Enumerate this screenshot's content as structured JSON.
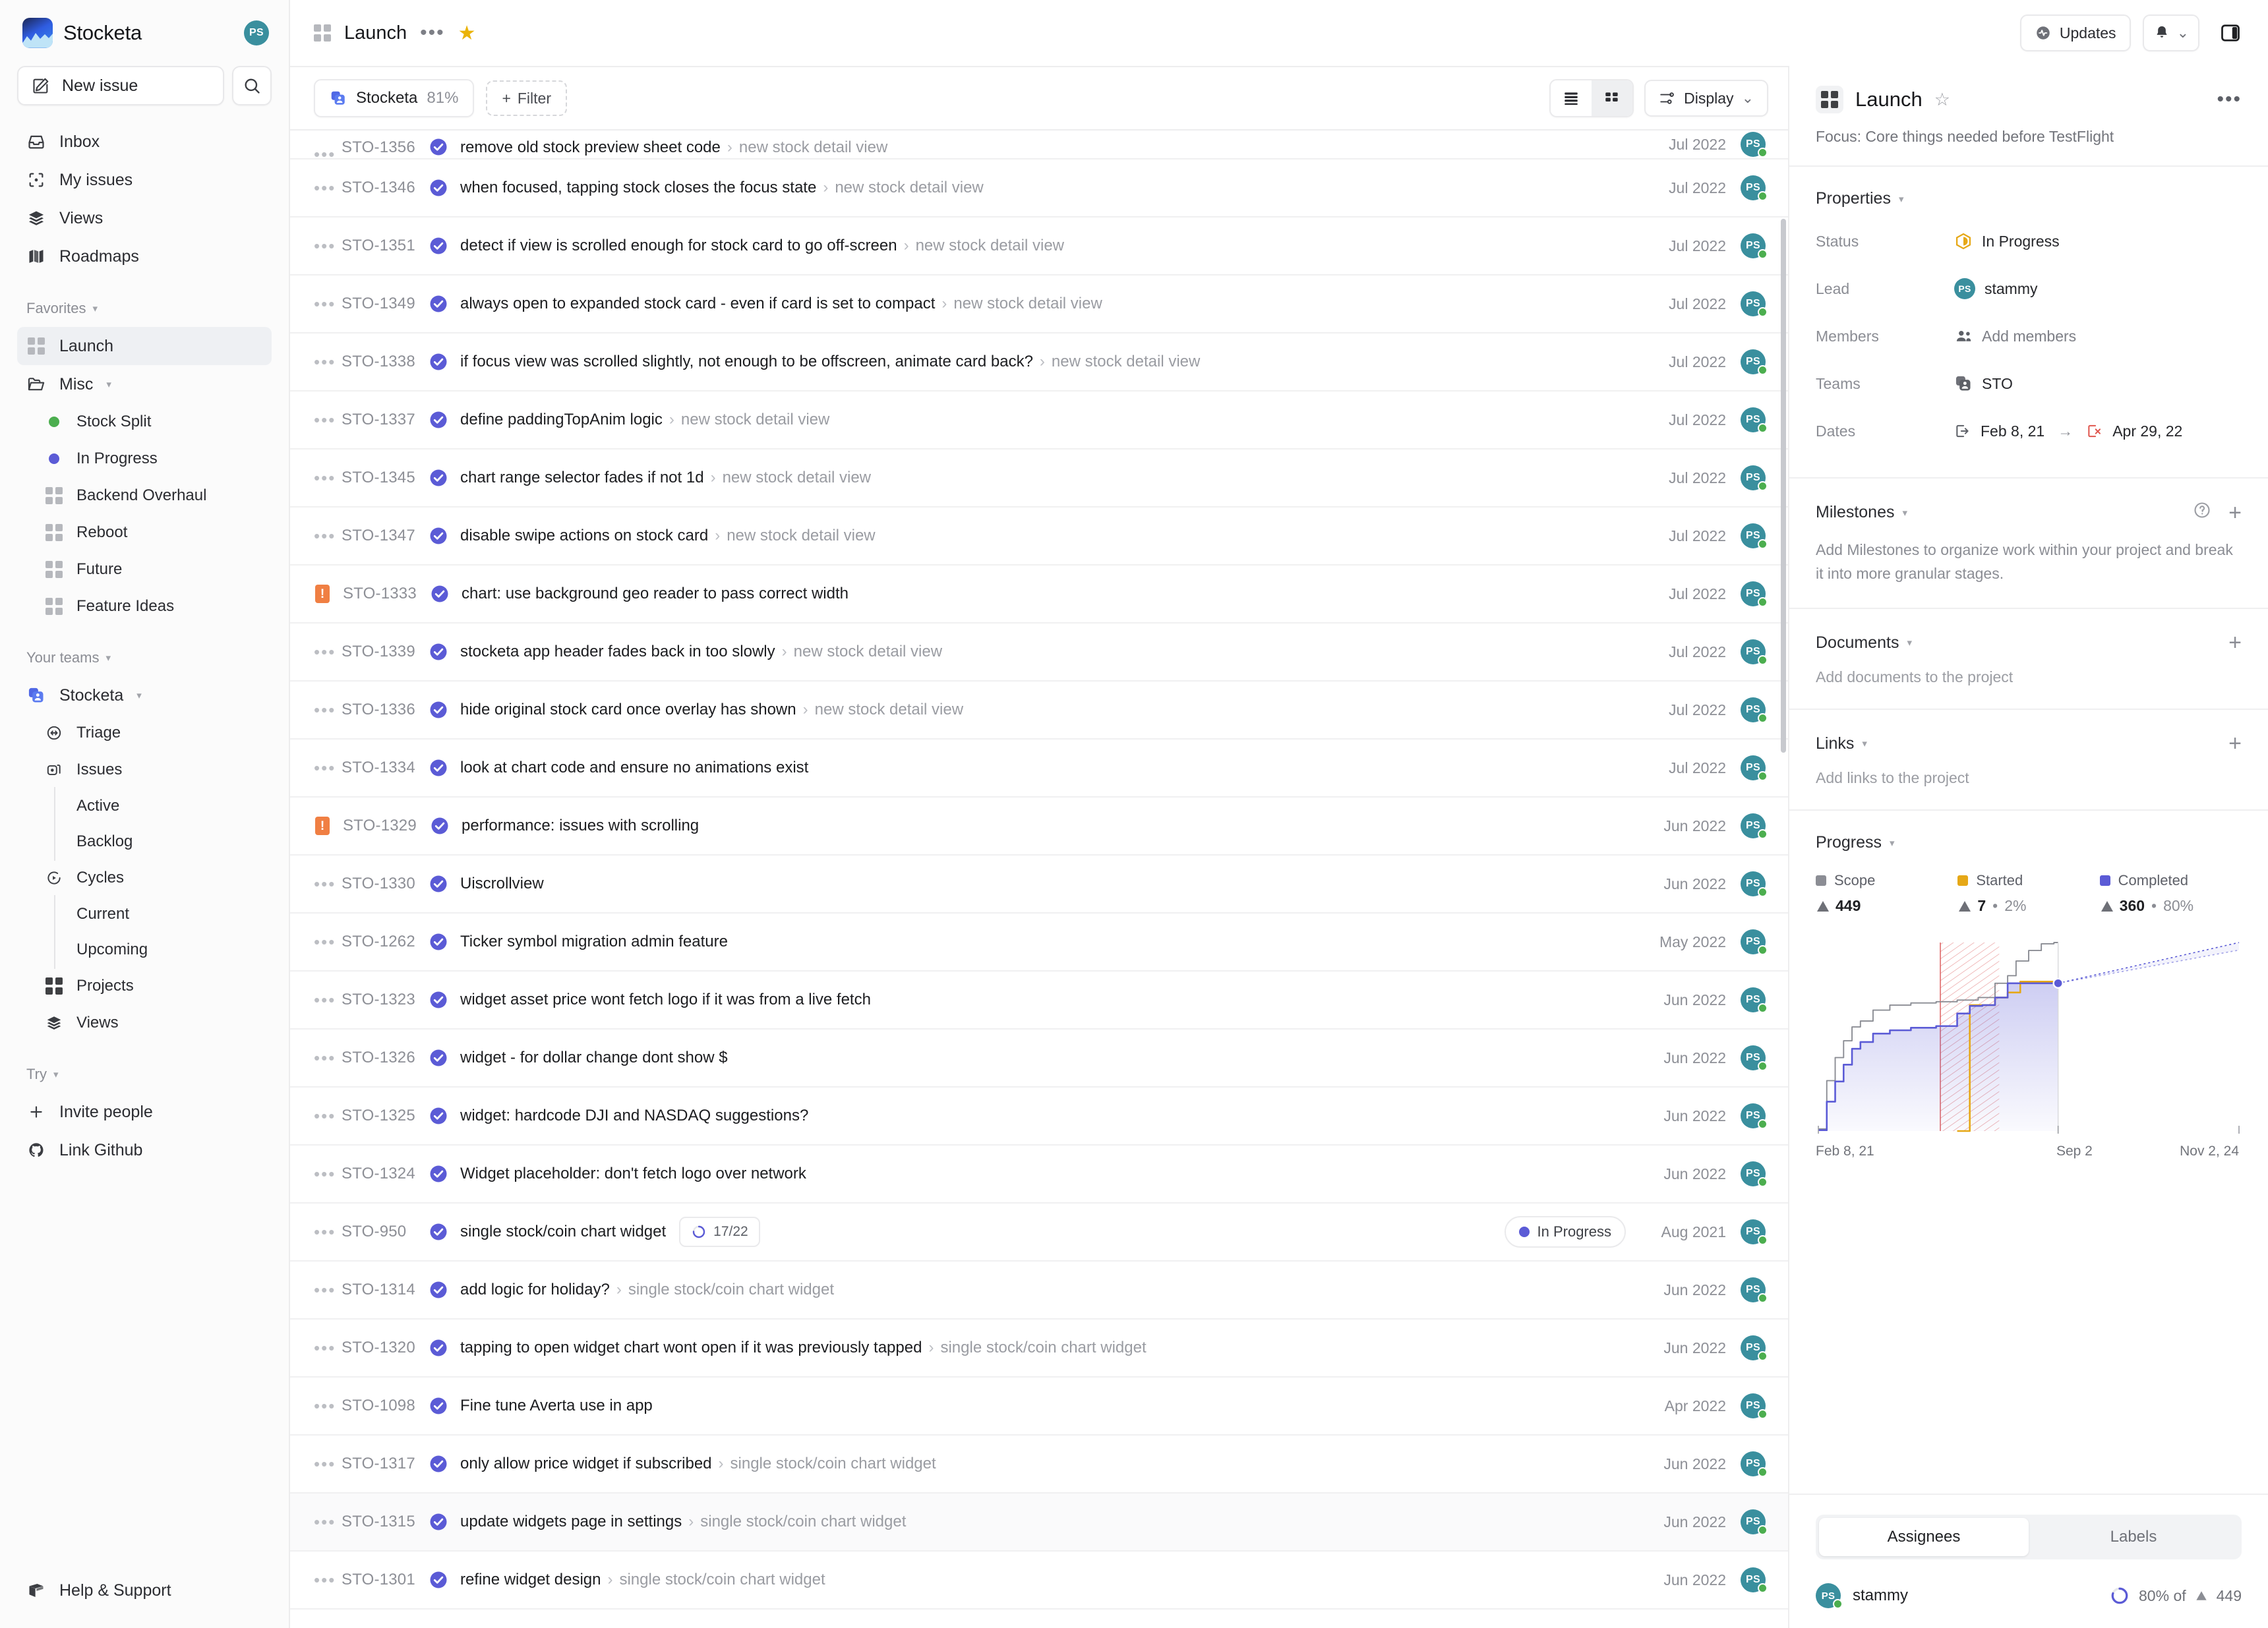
{
  "sidebar": {
    "brand": {
      "name": "Stocketa",
      "logo_icon": "stocketa-logo",
      "avatar_initials": "PS"
    },
    "new_issue_label": "New issue",
    "search_icon": "search-icon",
    "nav": [
      {
        "label": "Inbox",
        "icon": "inbox-icon"
      },
      {
        "label": "My issues",
        "icon": "my-issues-icon"
      },
      {
        "label": "Views",
        "icon": "views-layers-icon"
      },
      {
        "label": "Roadmaps",
        "icon": "roadmaps-map-icon"
      }
    ],
    "favorites_label": "Favorites",
    "favorites": [
      {
        "label": "Launch",
        "icon": "project-grid-icon",
        "active": true
      },
      {
        "label": "Misc",
        "icon": "folder-icon",
        "is_folder": true
      }
    ],
    "misc_children": [
      {
        "label": "Stock Split",
        "icon": "status-dot",
        "color": "#4cae4f"
      },
      {
        "label": "In Progress",
        "icon": "status-dot",
        "color": "#5b5bd6"
      },
      {
        "label": "Backend Overhaul",
        "icon": "project-grid-icon"
      },
      {
        "label": "Reboot",
        "icon": "project-grid-icon"
      },
      {
        "label": "Future",
        "icon": "project-grid-icon"
      },
      {
        "label": "Feature Ideas",
        "icon": "project-grid-icon"
      }
    ],
    "teams_label": "Your teams",
    "team": {
      "label": "Stocketa",
      "icon": "team-avatar-icon"
    },
    "team_children": [
      {
        "label": "Triage",
        "icon": "triage-icon",
        "depth": 1
      },
      {
        "label": "Issues",
        "icon": "issues-icon",
        "depth": 1
      },
      {
        "label": "Active",
        "depth": 2
      },
      {
        "label": "Backlog",
        "depth": 2
      },
      {
        "label": "Cycles",
        "icon": "cycles-icon",
        "depth": 1
      },
      {
        "label": "Current",
        "depth": 2
      },
      {
        "label": "Upcoming",
        "depth": 2
      },
      {
        "label": "Projects",
        "icon": "project-grid-icon",
        "depth": 1
      },
      {
        "label": "Views",
        "icon": "views-layers-icon",
        "depth": 1
      }
    ],
    "try_label": "Try",
    "try_items": [
      {
        "label": "Invite people",
        "icon": "plus-icon"
      },
      {
        "label": "Link Github",
        "icon": "github-icon"
      }
    ],
    "help_label": "Help & Support",
    "help_icon": "book-icon"
  },
  "topbar": {
    "project_icon": "project-grid-icon",
    "title": "Launch",
    "more_icon": "more-dots-icon",
    "favorite_icon": "star-filled-icon",
    "updates_label": "Updates",
    "updates_icon": "activity-icon",
    "bell_icon": "bell-icon",
    "chevron_icon": "chevron-down-icon",
    "panel_toggle_icon": "right-panel-toggle-icon"
  },
  "filterbar": {
    "team_chip": {
      "label": "Stocketa",
      "percent": "81%",
      "icon": "team-avatar-icon"
    },
    "filter_label": "Filter",
    "filter_plus": "+",
    "view_list_icon": "list-view-icon",
    "view_board_icon": "board-view-icon",
    "display_label": "Display",
    "display_icon": "sliders-icon",
    "display_chevron": "chevron-down-icon"
  },
  "issues": [
    {
      "id": "STO-1356",
      "title": "remove old stock preview sheet code",
      "breadcrumb": "new stock detail view",
      "date": "Jul 2022",
      "priority": "none",
      "status": "done",
      "avatar": "PS",
      "clipped": true
    },
    {
      "id": "STO-1346",
      "title": "when focused, tapping stock closes the focus state",
      "breadcrumb": "new stock detail view",
      "date": "Jul 2022",
      "priority": "none",
      "status": "done",
      "avatar": "PS"
    },
    {
      "id": "STO-1351",
      "title": "detect if view is scrolled enough for stock card to go off-screen",
      "breadcrumb": "new stock detail view",
      "date": "Jul 2022",
      "priority": "none",
      "status": "done",
      "avatar": "PS"
    },
    {
      "id": "STO-1349",
      "title": "always open to expanded stock card - even if card is set to compact",
      "breadcrumb": "new stock detail view",
      "date": "Jul 2022",
      "priority": "none",
      "status": "done",
      "avatar": "PS"
    },
    {
      "id": "STO-1338",
      "title": "if focus view was scrolled slightly, not enough to be offscreen, animate card back?",
      "breadcrumb": "new stock detail view",
      "date": "Jul 2022",
      "priority": "none",
      "status": "done",
      "avatar": "PS"
    },
    {
      "id": "STO-1337",
      "title": "define paddingTopAnim logic",
      "breadcrumb": "new stock detail view",
      "date": "Jul 2022",
      "priority": "none",
      "status": "done",
      "avatar": "PS"
    },
    {
      "id": "STO-1345",
      "title": "chart range selector fades if not 1d",
      "breadcrumb": "new stock detail view",
      "date": "Jul 2022",
      "priority": "none",
      "status": "done",
      "avatar": "PS"
    },
    {
      "id": "STO-1347",
      "title": "disable swipe actions on stock card",
      "breadcrumb": "new stock detail view",
      "date": "Jul 2022",
      "priority": "none",
      "status": "done",
      "avatar": "PS"
    },
    {
      "id": "STO-1333",
      "title": "chart: use background geo reader to pass correct width",
      "breadcrumb": "",
      "date": "Jul 2022",
      "priority": "urgent",
      "status": "done",
      "avatar": "PS"
    },
    {
      "id": "STO-1339",
      "title": "stocketa app header fades back in too slowly",
      "breadcrumb": "new stock detail view",
      "date": "Jul 2022",
      "priority": "none",
      "status": "done",
      "avatar": "PS"
    },
    {
      "id": "STO-1336",
      "title": "hide original stock card once overlay has shown",
      "breadcrumb": "new stock detail view",
      "date": "Jul 2022",
      "priority": "none",
      "status": "done",
      "avatar": "PS"
    },
    {
      "id": "STO-1334",
      "title": "look at chart code and ensure no animations exist",
      "breadcrumb": "",
      "date": "Jul 2022",
      "priority": "none",
      "status": "done",
      "avatar": "PS"
    },
    {
      "id": "STO-1329",
      "title": "performance: issues with scrolling",
      "breadcrumb": "",
      "date": "Jun 2022",
      "priority": "urgent",
      "status": "done",
      "avatar": "PS"
    },
    {
      "id": "STO-1330",
      "title": "Uiscrollview",
      "breadcrumb": "",
      "date": "Jun 2022",
      "priority": "none",
      "status": "done",
      "avatar": "PS"
    },
    {
      "id": "STO-1262",
      "title": "Ticker symbol migration admin feature",
      "breadcrumb": "",
      "date": "May 2022",
      "priority": "none",
      "status": "done",
      "avatar": "PS"
    },
    {
      "id": "STO-1323",
      "title": "widget asset price wont fetch logo if it was from a live fetch",
      "breadcrumb": "",
      "date": "Jun 2022",
      "priority": "none",
      "status": "done",
      "avatar": "PS"
    },
    {
      "id": "STO-1326",
      "title": "widget - for dollar change dont show $",
      "breadcrumb": "",
      "date": "Jun 2022",
      "priority": "none",
      "status": "done",
      "avatar": "PS"
    },
    {
      "id": "STO-1325",
      "title": "widget: hardcode DJI and NASDAQ suggestions?",
      "breadcrumb": "",
      "date": "Jun 2022",
      "priority": "none",
      "status": "done",
      "avatar": "PS"
    },
    {
      "id": "STO-1324",
      "title": "Widget placeholder: don't fetch logo over network",
      "breadcrumb": "",
      "date": "Jun 2022",
      "priority": "none",
      "status": "done",
      "avatar": "PS"
    },
    {
      "id": "STO-950",
      "title": "single stock/coin chart widget",
      "breadcrumb": "",
      "date": "Aug 2021",
      "priority": "none",
      "status": "done",
      "avatar": "PS",
      "sub_count": "17/22",
      "status_pill": "In Progress",
      "status_pill_color": "#5b5bd6"
    },
    {
      "id": "STO-1314",
      "title": "add logic for holiday?",
      "breadcrumb": "single stock/coin chart widget",
      "date": "Jun 2022",
      "priority": "none",
      "status": "done",
      "avatar": "PS"
    },
    {
      "id": "STO-1320",
      "title": "tapping to open widget chart wont open if it was previously tapped",
      "breadcrumb": "single stock/coin chart widget",
      "date": "Jun 2022",
      "priority": "none",
      "status": "done",
      "avatar": "PS"
    },
    {
      "id": "STO-1098",
      "title": "Fine tune Averta use in app",
      "breadcrumb": "",
      "date": "Apr 2022",
      "priority": "none",
      "status": "done",
      "avatar": "PS"
    },
    {
      "id": "STO-1317",
      "title": "only allow price widget if subscribed",
      "breadcrumb": "single stock/coin chart widget",
      "date": "Jun 2022",
      "priority": "none",
      "status": "done",
      "avatar": "PS"
    },
    {
      "id": "STO-1315",
      "title": "update widgets page in settings",
      "breadcrumb": "single stock/coin chart widget",
      "date": "Jun 2022",
      "priority": "none",
      "status": "done",
      "avatar": "PS",
      "hovered": true
    },
    {
      "id": "STO-1301",
      "title": "refine widget design",
      "breadcrumb": "single stock/coin chart widget",
      "date": "Jun 2022",
      "priority": "none",
      "status": "done",
      "avatar": "PS"
    }
  ],
  "panel": {
    "icon": "project-grid-icon",
    "title": "Launch",
    "star_icon": "star-outline-icon",
    "more_icon": "more-dots-icon",
    "description": "Focus: Core things needed before TestFlight",
    "properties": {
      "heading": "Properties",
      "rows": [
        {
          "label": "Status",
          "value": "In Progress",
          "icon": "status-in-progress-icon",
          "color": "#e6a817"
        },
        {
          "label": "Lead",
          "value": "stammy",
          "icon": "avatar",
          "initials": "PS"
        },
        {
          "label": "Members",
          "value": "Add members",
          "icon": "members-icon",
          "muted": true
        },
        {
          "label": "Teams",
          "value": "STO",
          "icon": "team-avatar-icon"
        }
      ],
      "dates_label": "Dates",
      "date_start": "Feb 8, 21",
      "date_end": "Apr 29, 22",
      "date_start_icon": "start-date-icon",
      "date_end_icon": "target-date-icon",
      "date_arrow": "→"
    },
    "milestones": {
      "heading": "Milestones",
      "help_icon": "help-circle-icon",
      "add_icon": "plus-icon",
      "empty_text": "Add Milestones to organize work within your project and break it into more granular stages."
    },
    "documents": {
      "heading": "Documents",
      "add_icon": "plus-icon",
      "empty_text": "Add documents to the project"
    },
    "links": {
      "heading": "Links",
      "add_icon": "plus-icon",
      "empty_text": "Add links to the project"
    },
    "progress": {
      "heading": "Progress"
    },
    "tabs": [
      {
        "label": "Assignees",
        "selected": true
      },
      {
        "label": "Labels",
        "selected": false
      }
    ],
    "assignee": {
      "initials": "PS",
      "name": "stammy",
      "progress_text": "80% of",
      "scope_text": "449",
      "progress_icon": "progress-ring-icon"
    }
  },
  "chart_data": {
    "type": "area",
    "title": "Progress",
    "xlabel": "",
    "ylabel": "",
    "x_ticks": [
      "Feb 8, 21",
      "Sep 2",
      "Nov 2, 24"
    ],
    "xlim": [
      "Feb 8, 21",
      "Nov 2, 24"
    ],
    "ylim": [
      0,
      449
    ],
    "grid": false,
    "legend_position": "top",
    "legend": [
      {
        "name": "Scope",
        "color": "#8b8d94",
        "value": 449,
        "value_label": "449",
        "percent": ""
      },
      {
        "name": "Started",
        "color": "#e6a817",
        "value": 7,
        "value_label": "7",
        "percent": "2%"
      },
      {
        "name": "Completed",
        "color": "#5b5bd6",
        "value": 360,
        "value_label": "360",
        "percent": "80%"
      }
    ],
    "series": [
      {
        "name": "Scope",
        "color": "#8b8d94",
        "x": [
          0,
          2,
          4,
          6,
          8,
          10,
          13,
          17,
          22,
          28,
          33,
          38,
          42,
          45,
          47,
          50,
          53,
          56,
          57
        ],
        "values": [
          5,
          120,
          175,
          215,
          248,
          262,
          288,
          300,
          305,
          308,
          312,
          318,
          352,
          370,
          405,
          430,
          446,
          449,
          449
        ]
      },
      {
        "name": "Started",
        "color": "#e6a817",
        "x": [
          33,
          36,
          39,
          42,
          45,
          48,
          52,
          57
        ],
        "values": [
          0,
          300,
          300,
          318,
          330,
          356,
          356,
          356
        ]
      },
      {
        "name": "Completed",
        "color": "#5b5bd6",
        "x": [
          0,
          2,
          4,
          6,
          8,
          10,
          13,
          17,
          22,
          28,
          33,
          36,
          39,
          42,
          45,
          48,
          52,
          57
        ],
        "values": [
          2,
          70,
          118,
          158,
          196,
          212,
          232,
          240,
          246,
          250,
          280,
          298,
          300,
          318,
          352,
          352,
          352,
          352
        ]
      }
    ],
    "today_marker": {
      "x": 57,
      "label": "Sep 2",
      "value": 352
    },
    "projection": {
      "from_x": 57,
      "to_x": 100,
      "upper": 449,
      "lower": 449,
      "style": "dotted",
      "color": "#5b5bd6"
    },
    "overdue_band": {
      "from_x": 29,
      "to_x": 43,
      "hatch": true,
      "color": "#d94f4f"
    }
  }
}
